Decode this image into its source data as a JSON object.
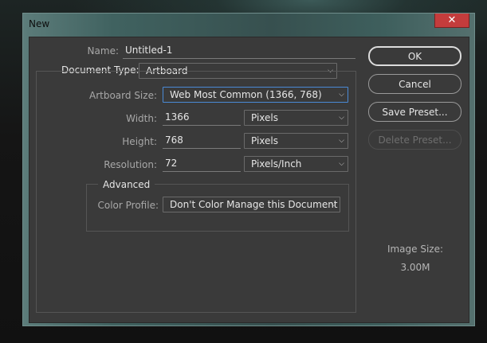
{
  "window": {
    "title": "New",
    "close_glyph": "✕"
  },
  "form": {
    "name_label": "Name:",
    "name_value": "Untitled-1",
    "doctype_label": "Document Type:",
    "doctype_value": "Artboard",
    "artboard_size_label": "Artboard Size:",
    "artboard_size_value": "Web Most Common (1366, 768)",
    "width_label": "Width:",
    "width_value": "1366",
    "width_unit": "Pixels",
    "height_label": "Height:",
    "height_value": "768",
    "height_unit": "Pixels",
    "resolution_label": "Resolution:",
    "resolution_value": "72",
    "resolution_unit": "Pixels/Inch",
    "advanced_label": "Advanced",
    "color_profile_label": "Color Profile:",
    "color_profile_value": "Don't Color Manage this Document"
  },
  "buttons": {
    "ok": "OK",
    "cancel": "Cancel",
    "save_preset": "Save Preset...",
    "delete_preset": "Delete Preset..."
  },
  "image_size": {
    "label": "Image Size:",
    "value": "3.00M"
  },
  "icons": {
    "dropdown": "chevron-down-icon",
    "close": "close-icon"
  },
  "colors": {
    "focus_border": "#4a8ad6",
    "close_button": "#c43c3c",
    "panel_bg": "#3a3a3a"
  }
}
